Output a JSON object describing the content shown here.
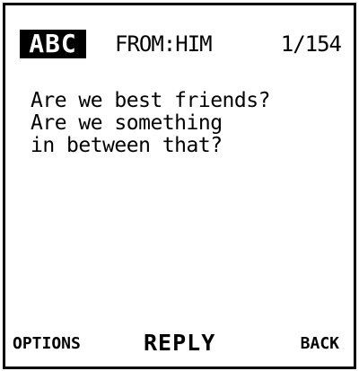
{
  "header": {
    "mode": "ABC",
    "sender": "FROM:HIM",
    "counter": "1/154"
  },
  "message": {
    "lines": [
      "Are we best friends?",
      "Are we something",
      "in between that?"
    ]
  },
  "softkeys": {
    "left": "OPTIONS",
    "center": "REPLY",
    "right": "BACK"
  }
}
